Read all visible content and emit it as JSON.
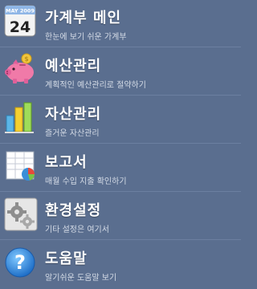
{
  "menu": {
    "items": [
      {
        "title": "가계부 메인",
        "subtitle": "한눈에 보기 쉬운 가계부",
        "icon": "calendar-icon"
      },
      {
        "title": "예산관리",
        "subtitle": "계획적인 예산관리로 절약하기",
        "icon": "piggy-bank-icon"
      },
      {
        "title": "자산관리",
        "subtitle": "즐거운 자산관리",
        "icon": "bar-chart-icon"
      },
      {
        "title": "보고서",
        "subtitle": "매월 수입 지출 확인하기",
        "icon": "report-icon"
      },
      {
        "title": "환경설정",
        "subtitle": "기타 설정은 여기서",
        "icon": "gears-icon"
      },
      {
        "title": "도움말",
        "subtitle": "알기쉬운 도움말 보기",
        "icon": "help-icon"
      }
    ],
    "calendar_icon": {
      "month": "MAY 2009",
      "day": "24"
    }
  }
}
